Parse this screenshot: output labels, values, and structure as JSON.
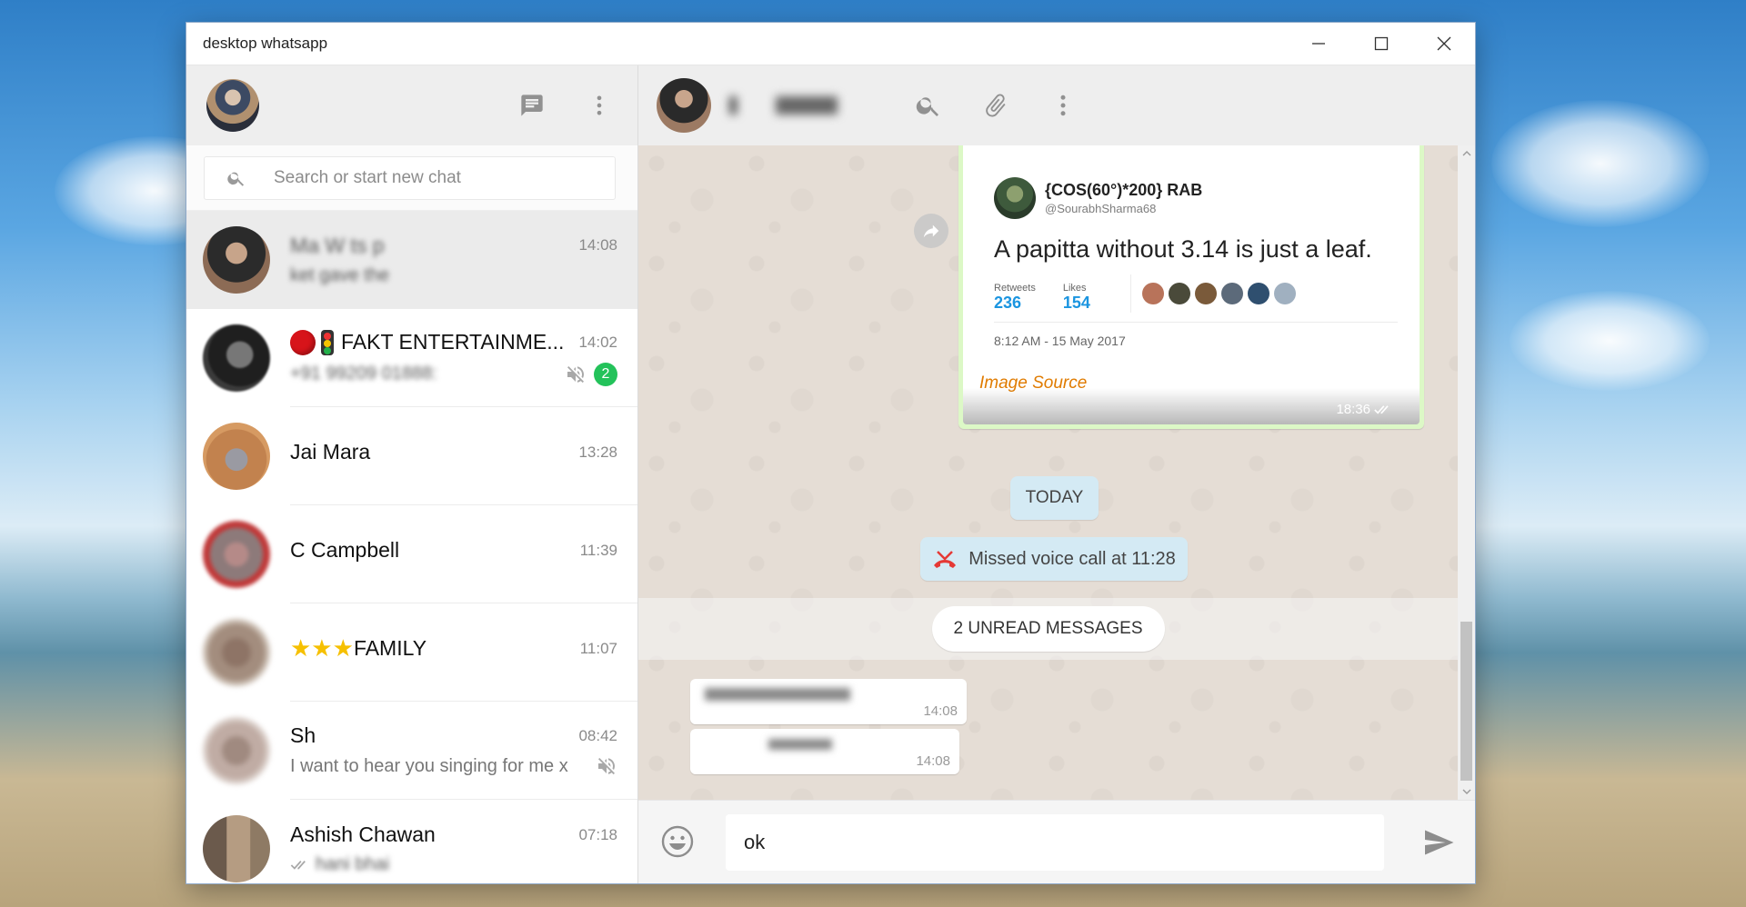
{
  "window": {
    "title": "desktop whatsapp"
  },
  "sidebar": {
    "search_placeholder": "Search or start new chat",
    "chats": [
      {
        "name": "Ma   W  ts  p",
        "time": "14:08",
        "preview": "   ket gave the",
        "active": true
      },
      {
        "name": "FAKT ENTERTAINME...",
        "time": "14:02",
        "preview": "+91 99209 01888:",
        "muted": true,
        "unread": "2"
      },
      {
        "name": "Jai  Mara",
        "time": "13:28",
        "preview": "  "
      },
      {
        "name": "C    Campbell",
        "time": "11:39",
        "preview": "  "
      },
      {
        "name": "FAMILY",
        "time": "11:07",
        "preview": "  "
      },
      {
        "name": "Sh",
        "time": "08:42",
        "preview": "I want to hear you singing for me x",
        "muted": true
      },
      {
        "name": "Ashish Chawan",
        "time": "07:18",
        "preview": "hani bhai"
      }
    ]
  },
  "conversation": {
    "contact_name": "      ",
    "tweet": {
      "author": "{COS(60°)*200} RAB",
      "handle": "@SourabhSharma68",
      "text": "A papitta without 3.14 is just a leaf.",
      "retweets_label": "Retweets",
      "retweets": "236",
      "likes_label": "Likes",
      "likes": "154",
      "date": "8:12 AM - 15 May 2017",
      "image_source": "Image Source",
      "time": "18:36"
    },
    "date_divider": "TODAY",
    "missed_call": "Missed voice call at 11:28",
    "unread_divider": "2 UNREAD MESSAGES",
    "incoming": [
      {
        "text": "          ",
        "time": "14:08"
      },
      {
        "text": "      ",
        "time": "14:08"
      }
    ]
  },
  "composer": {
    "value": "ok"
  },
  "colors": {
    "accent_green": "#23c25a",
    "bubble_out": "#dcf8c6",
    "system_pill": "#d4eaf4",
    "link_blue": "#1b95e0",
    "image_source_orange": "#e07b00"
  }
}
